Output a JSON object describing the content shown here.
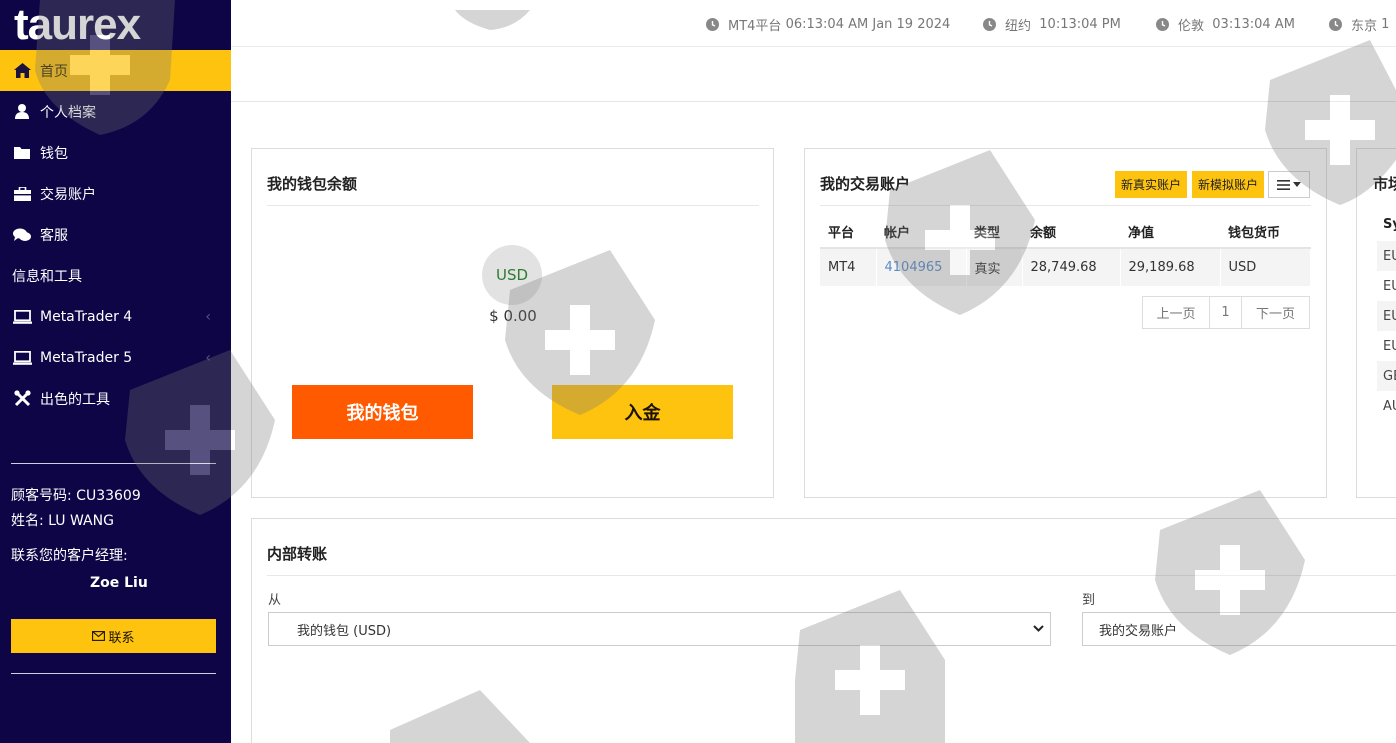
{
  "brand": {
    "logo_text": "taurex"
  },
  "sidebar": {
    "items": [
      {
        "label": "首页",
        "icon": "home-icon"
      },
      {
        "label": "个人档案",
        "icon": "user-icon"
      },
      {
        "label": "钱包",
        "icon": "folder-icon"
      },
      {
        "label": "交易账户",
        "icon": "briefcase-icon"
      },
      {
        "label": "客服",
        "icon": "chat-icon"
      }
    ],
    "section_label": "信息和工具",
    "tools": [
      {
        "label": "MetaTrader 4",
        "icon": "laptop-icon"
      },
      {
        "label": "MetaTrader 5",
        "icon": "laptop-icon"
      },
      {
        "label": "出色的工具",
        "icon": "tools-icon"
      }
    ],
    "client_number": "顾客号码: CU33609",
    "name": "姓名: LU WANG",
    "manager_label": "联系您的客户经理:",
    "manager_name": "Zoe Liu",
    "contact_label": "联系"
  },
  "clocks": [
    {
      "label": "MT4平台",
      "time": "06:13:04 AM",
      "date": "Jan 19 2024"
    },
    {
      "label": "纽约",
      "time": "10:13:04 PM"
    },
    {
      "label": "伦敦",
      "time": "03:13:04 AM"
    },
    {
      "label": "东京",
      "time": "1"
    }
  ],
  "wallet": {
    "title": "我的钱包余额",
    "currency": "USD",
    "balance": "$ 0.00",
    "wallet_button": "我的钱包",
    "deposit_button": "入金"
  },
  "accounts": {
    "title": "我的交易账户",
    "new_live_button": "新真实账户",
    "new_demo_button": "新模拟账户",
    "columns": [
      "平台",
      "帐户",
      "类型",
      "余额",
      "净值",
      "钱包货币"
    ],
    "rows": [
      {
        "platform": "MT4",
        "account": "4104965",
        "type": "真实",
        "balance": "28,749.68",
        "equity": "29,189.68",
        "currency": "USD"
      }
    ],
    "pager": {
      "prev": "上一页",
      "page": "1",
      "next": "下一页"
    }
  },
  "market": {
    "title": "市场",
    "column": "Sy",
    "symbols": [
      "EU",
      "EU",
      "EU",
      "EU",
      "GB",
      "AU"
    ]
  },
  "transfer": {
    "title": "内部转账",
    "from_label": "从",
    "from_value": "我的钱包 (USD)",
    "to_label": "到",
    "to_value": "我的交易账户"
  },
  "colors": {
    "sidebar_bg": "#0d0546",
    "accent_yellow": "#fdc30f",
    "accent_orange": "#ff5a00",
    "link_blue": "#5a8bc9"
  }
}
